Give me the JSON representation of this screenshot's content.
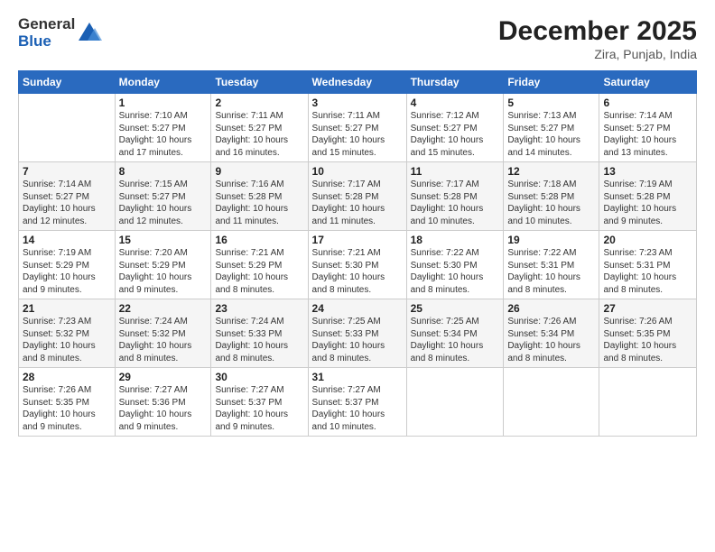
{
  "header": {
    "logo_general": "General",
    "logo_blue": "Blue",
    "month_year": "December 2025",
    "location": "Zira, Punjab, India"
  },
  "calendar": {
    "days_of_week": [
      "Sunday",
      "Monday",
      "Tuesday",
      "Wednesday",
      "Thursday",
      "Friday",
      "Saturday"
    ],
    "weeks": [
      [
        {
          "day": "",
          "info": ""
        },
        {
          "day": "1",
          "info": "Sunrise: 7:10 AM\nSunset: 5:27 PM\nDaylight: 10 hours\nand 17 minutes."
        },
        {
          "day": "2",
          "info": "Sunrise: 7:11 AM\nSunset: 5:27 PM\nDaylight: 10 hours\nand 16 minutes."
        },
        {
          "day": "3",
          "info": "Sunrise: 7:11 AM\nSunset: 5:27 PM\nDaylight: 10 hours\nand 15 minutes."
        },
        {
          "day": "4",
          "info": "Sunrise: 7:12 AM\nSunset: 5:27 PM\nDaylight: 10 hours\nand 15 minutes."
        },
        {
          "day": "5",
          "info": "Sunrise: 7:13 AM\nSunset: 5:27 PM\nDaylight: 10 hours\nand 14 minutes."
        },
        {
          "day": "6",
          "info": "Sunrise: 7:14 AM\nSunset: 5:27 PM\nDaylight: 10 hours\nand 13 minutes."
        }
      ],
      [
        {
          "day": "7",
          "info": "Sunrise: 7:14 AM\nSunset: 5:27 PM\nDaylight: 10 hours\nand 12 minutes."
        },
        {
          "day": "8",
          "info": "Sunrise: 7:15 AM\nSunset: 5:27 PM\nDaylight: 10 hours\nand 12 minutes."
        },
        {
          "day": "9",
          "info": "Sunrise: 7:16 AM\nSunset: 5:28 PM\nDaylight: 10 hours\nand 11 minutes."
        },
        {
          "day": "10",
          "info": "Sunrise: 7:17 AM\nSunset: 5:28 PM\nDaylight: 10 hours\nand 11 minutes."
        },
        {
          "day": "11",
          "info": "Sunrise: 7:17 AM\nSunset: 5:28 PM\nDaylight: 10 hours\nand 10 minutes."
        },
        {
          "day": "12",
          "info": "Sunrise: 7:18 AM\nSunset: 5:28 PM\nDaylight: 10 hours\nand 10 minutes."
        },
        {
          "day": "13",
          "info": "Sunrise: 7:19 AM\nSunset: 5:28 PM\nDaylight: 10 hours\nand 9 minutes."
        }
      ],
      [
        {
          "day": "14",
          "info": "Sunrise: 7:19 AM\nSunset: 5:29 PM\nDaylight: 10 hours\nand 9 minutes."
        },
        {
          "day": "15",
          "info": "Sunrise: 7:20 AM\nSunset: 5:29 PM\nDaylight: 10 hours\nand 9 minutes."
        },
        {
          "day": "16",
          "info": "Sunrise: 7:21 AM\nSunset: 5:29 PM\nDaylight: 10 hours\nand 8 minutes."
        },
        {
          "day": "17",
          "info": "Sunrise: 7:21 AM\nSunset: 5:30 PM\nDaylight: 10 hours\nand 8 minutes."
        },
        {
          "day": "18",
          "info": "Sunrise: 7:22 AM\nSunset: 5:30 PM\nDaylight: 10 hours\nand 8 minutes."
        },
        {
          "day": "19",
          "info": "Sunrise: 7:22 AM\nSunset: 5:31 PM\nDaylight: 10 hours\nand 8 minutes."
        },
        {
          "day": "20",
          "info": "Sunrise: 7:23 AM\nSunset: 5:31 PM\nDaylight: 10 hours\nand 8 minutes."
        }
      ],
      [
        {
          "day": "21",
          "info": "Sunrise: 7:23 AM\nSunset: 5:32 PM\nDaylight: 10 hours\nand 8 minutes."
        },
        {
          "day": "22",
          "info": "Sunrise: 7:24 AM\nSunset: 5:32 PM\nDaylight: 10 hours\nand 8 minutes."
        },
        {
          "day": "23",
          "info": "Sunrise: 7:24 AM\nSunset: 5:33 PM\nDaylight: 10 hours\nand 8 minutes."
        },
        {
          "day": "24",
          "info": "Sunrise: 7:25 AM\nSunset: 5:33 PM\nDaylight: 10 hours\nand 8 minutes."
        },
        {
          "day": "25",
          "info": "Sunrise: 7:25 AM\nSunset: 5:34 PM\nDaylight: 10 hours\nand 8 minutes."
        },
        {
          "day": "26",
          "info": "Sunrise: 7:26 AM\nSunset: 5:34 PM\nDaylight: 10 hours\nand 8 minutes."
        },
        {
          "day": "27",
          "info": "Sunrise: 7:26 AM\nSunset: 5:35 PM\nDaylight: 10 hours\nand 8 minutes."
        }
      ],
      [
        {
          "day": "28",
          "info": "Sunrise: 7:26 AM\nSunset: 5:35 PM\nDaylight: 10 hours\nand 9 minutes."
        },
        {
          "day": "29",
          "info": "Sunrise: 7:27 AM\nSunset: 5:36 PM\nDaylight: 10 hours\nand 9 minutes."
        },
        {
          "day": "30",
          "info": "Sunrise: 7:27 AM\nSunset: 5:37 PM\nDaylight: 10 hours\nand 9 minutes."
        },
        {
          "day": "31",
          "info": "Sunrise: 7:27 AM\nSunset: 5:37 PM\nDaylight: 10 hours\nand 10 minutes."
        },
        {
          "day": "",
          "info": ""
        },
        {
          "day": "",
          "info": ""
        },
        {
          "day": "",
          "info": ""
        }
      ]
    ]
  }
}
